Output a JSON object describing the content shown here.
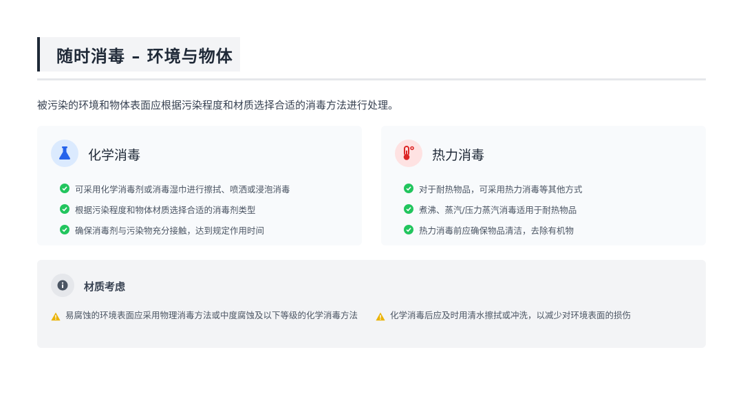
{
  "header": {
    "title": "随时消毒 – 环境与物体"
  },
  "intro": "被污染的环境和物体表面应根据污染程度和材质选择合适的消毒方法进行处理。",
  "cards": {
    "chemical": {
      "icon": "flask-icon",
      "title": "化学消毒",
      "items": [
        "可采用化学消毒剂或消毒湿巾进行擦拭、喷洒或浸泡消毒",
        "根据污染程度和物体材质选择合适的消毒剂类型",
        "确保消毒剂与污染物充分接触，达到规定作用时间"
      ]
    },
    "thermal": {
      "icon": "thermometer-icon",
      "title": "热力消毒",
      "items": [
        "对于耐热物品，可采用热力消毒等其他方式",
        "煮沸、蒸汽/压力蒸汽消毒适用于耐热物品",
        "热力消毒前应确保物品清洁，去除有机物"
      ]
    }
  },
  "material": {
    "icon": "info-icon",
    "title": "材质考虑",
    "items": [
      "易腐蚀的环境表面应采用物理消毒方法或中度腐蚀及以下等级的化学消毒方法",
      "化学消毒后应及时用清水擦拭或冲洗，以减少对环境表面的损伤"
    ]
  },
  "colors": {
    "accent_blue": "#2563eb",
    "accent_red": "#dc2626",
    "check_green": "#22c55e",
    "warning_yellow": "#eab308"
  }
}
